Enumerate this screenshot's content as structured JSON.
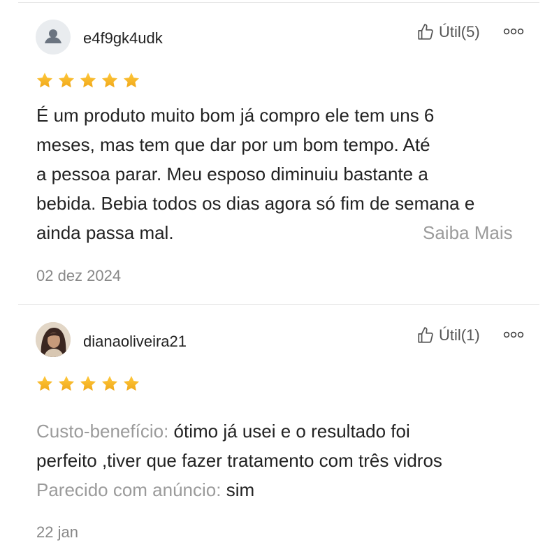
{
  "reviews": [
    {
      "username": "e4f9gk4udk",
      "avatar_icon": "default-user-icon",
      "helpful_label": "Útil(5)",
      "rating": 5,
      "text_lines": [
        "É um produto muito bom já compro ele tem uns 6",
        "meses, mas tem que dar por um bom tempo. Até",
        "a pessoa parar. Meu esposo diminuiu bastante a",
        "bebida. Bebia todos os dias agora só fim de semana e",
        "ainda passa mal."
      ],
      "read_more": "Saiba Mais",
      "date": "02 dez 2024"
    },
    {
      "username": "dianaoliveira21",
      "avatar_icon": "user-photo",
      "helpful_label": "Útil(1)",
      "rating": 5,
      "attributes": [
        {
          "label": "Custo-benefício:",
          "value": " ótimo já usei e o resultado foi"
        },
        {
          "label": "",
          "value": "perfeito ,tiver que fazer tratamento com três vidros"
        },
        {
          "label": "Parecido com anúncio:",
          "value": " sim"
        }
      ],
      "date": "22 jan"
    }
  ],
  "colors": {
    "star": "#f5b623",
    "muted_text": "#9b9b9b",
    "body_text": "#222222"
  }
}
